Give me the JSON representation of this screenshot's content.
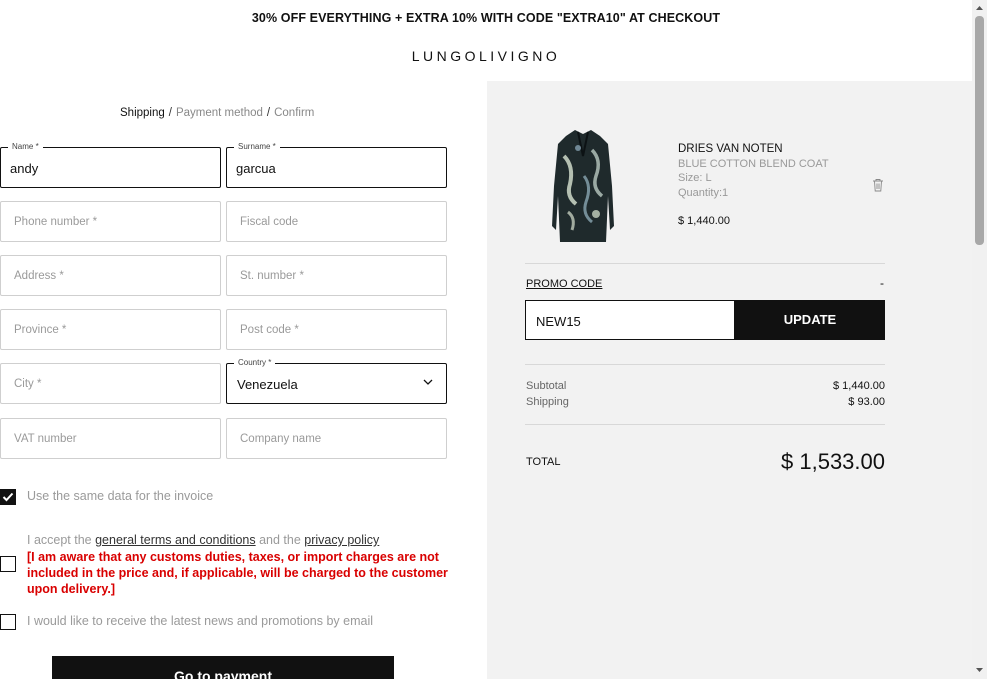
{
  "banner": {
    "text": "30% OFF EVERYTHING + EXTRA 10% WITH CODE \"EXTRA10\" AT CHECKOUT"
  },
  "brand": {
    "logo": "LUNGOLIVIGNO"
  },
  "breadcrumb": {
    "step1": "Shipping",
    "step2": "Payment method",
    "step3": "Confirm",
    "separator": "/"
  },
  "form": {
    "name": {
      "label": "Name *",
      "value": "andy"
    },
    "surname": {
      "label": "Surname *",
      "value": "garcua"
    },
    "phone": {
      "placeholder": "Phone number *"
    },
    "fiscal": {
      "placeholder": "Fiscal code"
    },
    "address": {
      "placeholder": "Address *"
    },
    "street_number": {
      "placeholder": "St. number *"
    },
    "province": {
      "placeholder": "Province *"
    },
    "postcode": {
      "placeholder": "Post code *"
    },
    "city": {
      "placeholder": "City *"
    },
    "country": {
      "label": "Country *",
      "value": "Venezuela"
    },
    "vat": {
      "placeholder": "VAT number"
    },
    "company": {
      "placeholder": "Company name"
    }
  },
  "checks": {
    "same_data": {
      "label": "Use the same data for the invoice",
      "checked": true
    },
    "terms": {
      "prefix": "I accept the ",
      "terms_link": "general terms and conditions",
      "middle": " and the ",
      "privacy_link": "privacy policy",
      "warning": "[I am aware that any customs duties, taxes, or import charges are not included in the price and, if applicable, will be charged to the customer upon delivery.]",
      "checked": false
    },
    "newsletter": {
      "label": "I would like to receive the latest news and promotions by email",
      "checked": false
    }
  },
  "actions": {
    "go_to_payment": "Go to payment"
  },
  "summary": {
    "product": {
      "brand": "DRIES VAN NOTEN",
      "name": "BLUE COTTON BLEND COAT",
      "size": "Size: L",
      "quantity": "Quantity:1",
      "price": "$ 1,440.00"
    },
    "promo": {
      "title": "PROMO CODE",
      "toggle": "-",
      "input_value": "NEW15",
      "button": "UPDATE"
    },
    "subtotal_label": "Subtotal",
    "subtotal_value": "$ 1,440.00",
    "shipping_label": "Shipping",
    "shipping_value": "$ 93.00",
    "total_label": "TOTAL",
    "total_value": "$ 1,533.00"
  },
  "colors": {
    "accent": "#111111",
    "warning": "#d90000",
    "panel": "#f2f2f2"
  },
  "icons": {
    "chevron": "chevron-down-icon",
    "trash": "trash-icon",
    "check": "checkmark-icon"
  }
}
